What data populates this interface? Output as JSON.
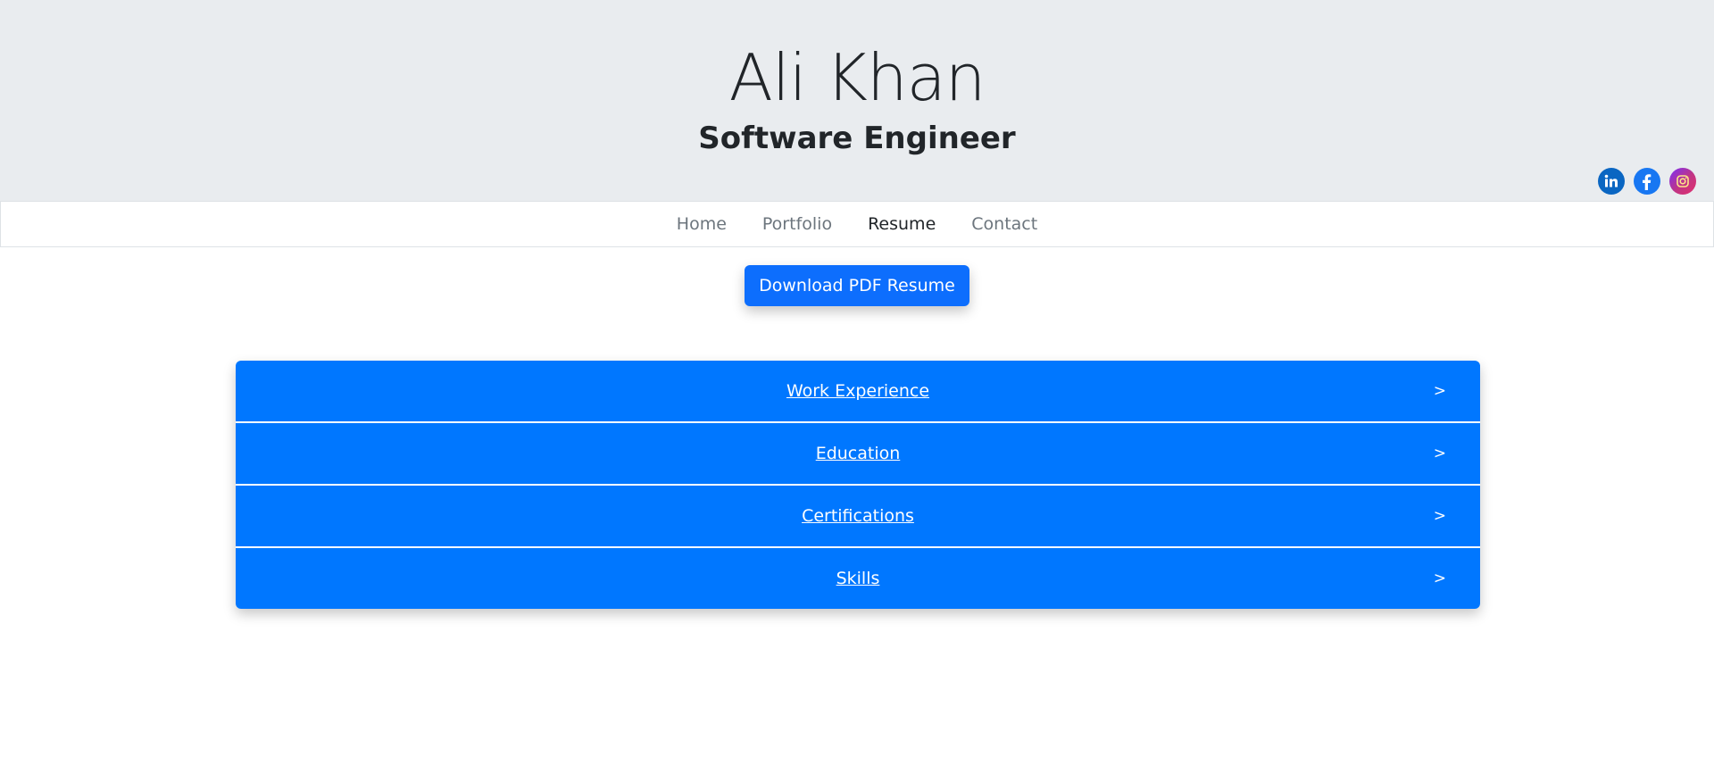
{
  "hero": {
    "name": "Ali Khan",
    "role": "Software Engineer"
  },
  "social": [
    {
      "name": "linkedin",
      "icon": "linkedin-icon",
      "color": "#0a66c2"
    },
    {
      "name": "facebook",
      "icon": "facebook-icon",
      "color": "#1877f2"
    },
    {
      "name": "instagram",
      "icon": "instagram-icon",
      "color": "#c13584"
    }
  ],
  "nav": {
    "items": [
      {
        "label": "Home",
        "active": false
      },
      {
        "label": "Portfolio",
        "active": false
      },
      {
        "label": "Resume",
        "active": true
      },
      {
        "label": "Contact",
        "active": false
      }
    ]
  },
  "download": {
    "label": "Download PDF Resume",
    "color": "#0d6efd"
  },
  "accordion": {
    "color": "#0077ff",
    "items": [
      {
        "label": "Work Experience",
        "chevron": ">"
      },
      {
        "label": "Education",
        "chevron": ">"
      },
      {
        "label": "Certifications",
        "chevron": ">"
      },
      {
        "label": "Skills",
        "chevron": ">"
      }
    ]
  }
}
